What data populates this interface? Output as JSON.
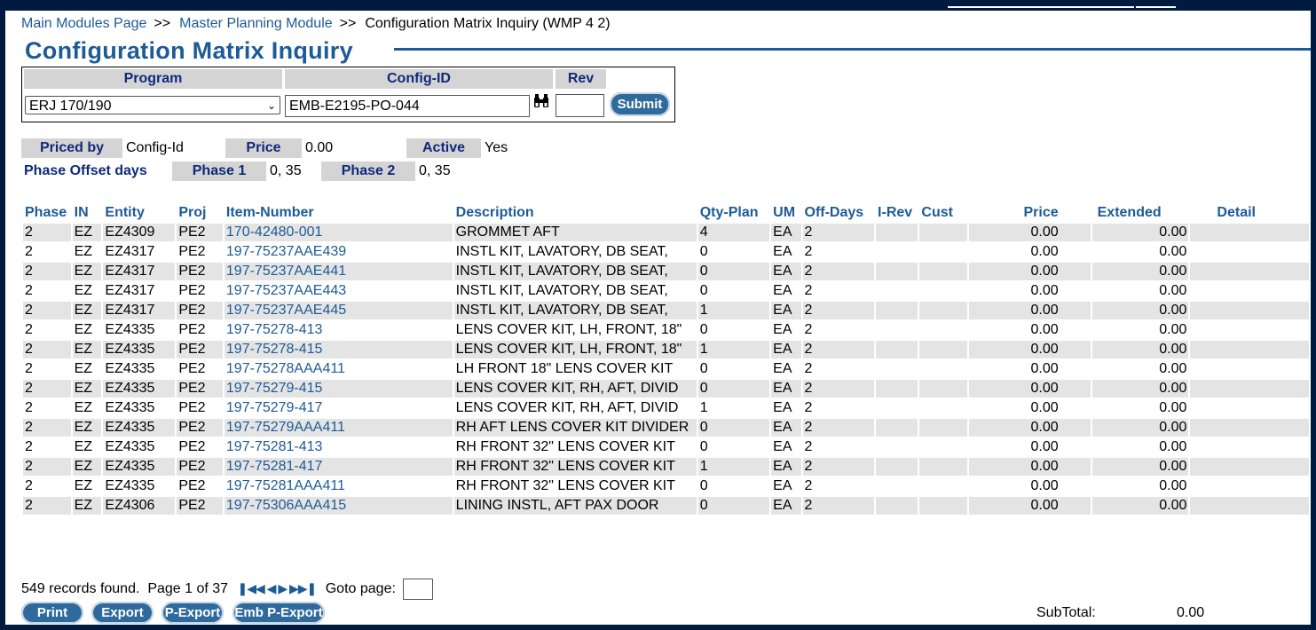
{
  "breadcrumb": {
    "main": "Main Modules Page",
    "sep1": ">>",
    "module": "Master Planning Module",
    "sep2": ">>",
    "current": "Configuration Matrix Inquiry (WMP 4 2)"
  },
  "title": "Configuration Matrix Inquiry",
  "filters": {
    "program_label": "Program",
    "config_label": "Config-ID",
    "rev_label": "Rev",
    "program_value": "ERJ 170/190",
    "config_value": "EMB-E2195-PO-044",
    "rev_value": "",
    "submit_label": "Submit"
  },
  "info": {
    "priced_by_label": "Priced by",
    "priced_by_value": "Config-Id",
    "price_label": "Price",
    "price_value": "0.00",
    "active_label": "Active",
    "active_value": "Yes",
    "phase_offset_label": "Phase Offset days",
    "phase1_label": "Phase 1",
    "phase1_value": "0, 35",
    "phase2_label": "Phase 2",
    "phase2_value": "0, 35"
  },
  "table": {
    "headers": [
      "Phase",
      "IN",
      "Entity",
      "Proj",
      "Item-Number",
      "Description",
      "Qty-Plan",
      "UM",
      "Off-Days",
      "I-Rev",
      "Cust",
      "Price",
      "Extended",
      "Detail"
    ],
    "rows": [
      [
        "2",
        "EZ",
        "EZ4309",
        "PE2",
        "170-42480-001",
        "GROMMET AFT",
        "4",
        "EA",
        "2",
        "",
        "",
        "0.00",
        "0.00",
        ""
      ],
      [
        "2",
        "EZ",
        "EZ4317",
        "PE2",
        "197-75237AAE439",
        "INSTL KIT, LAVATORY, DB SEAT,",
        "0",
        "EA",
        "2",
        "",
        "",
        "0.00",
        "0.00",
        ""
      ],
      [
        "2",
        "EZ",
        "EZ4317",
        "PE2",
        "197-75237AAE441",
        "INSTL KIT, LAVATORY, DB SEAT,",
        "0",
        "EA",
        "2",
        "",
        "",
        "0.00",
        "0.00",
        ""
      ],
      [
        "2",
        "EZ",
        "EZ4317",
        "PE2",
        "197-75237AAE443",
        "INSTL KIT, LAVATORY, DB SEAT,",
        "0",
        "EA",
        "2",
        "",
        "",
        "0.00",
        "0.00",
        ""
      ],
      [
        "2",
        "EZ",
        "EZ4317",
        "PE2",
        "197-75237AAE445",
        "INSTL KIT, LAVATORY, DB SEAT,",
        "1",
        "EA",
        "2",
        "",
        "",
        "0.00",
        "0.00",
        ""
      ],
      [
        "2",
        "EZ",
        "EZ4335",
        "PE2",
        "197-75278-413",
        "LENS COVER KIT, LH, FRONT, 18\"",
        "0",
        "EA",
        "2",
        "",
        "",
        "0.00",
        "0.00",
        ""
      ],
      [
        "2",
        "EZ",
        "EZ4335",
        "PE2",
        "197-75278-415",
        "LENS COVER KIT, LH, FRONT, 18\"",
        "1",
        "EA",
        "2",
        "",
        "",
        "0.00",
        "0.00",
        ""
      ],
      [
        "2",
        "EZ",
        "EZ4335",
        "PE2",
        "197-75278AAA411",
        "LH FRONT 18\" LENS COVER KIT",
        "0",
        "EA",
        "2",
        "",
        "",
        "0.00",
        "0.00",
        ""
      ],
      [
        "2",
        "EZ",
        "EZ4335",
        "PE2",
        "197-75279-415",
        "LENS COVER KIT, RH, AFT, DIVID",
        "0",
        "EA",
        "2",
        "",
        "",
        "0.00",
        "0.00",
        ""
      ],
      [
        "2",
        "EZ",
        "EZ4335",
        "PE2",
        "197-75279-417",
        "LENS COVER KIT, RH, AFT, DIVID",
        "1",
        "EA",
        "2",
        "",
        "",
        "0.00",
        "0.00",
        ""
      ],
      [
        "2",
        "EZ",
        "EZ4335",
        "PE2",
        "197-75279AAA411",
        "RH AFT LENS COVER KIT DIVIDER",
        "0",
        "EA",
        "2",
        "",
        "",
        "0.00",
        "0.00",
        ""
      ],
      [
        "2",
        "EZ",
        "EZ4335",
        "PE2",
        "197-75281-413",
        "RH FRONT 32\" LENS COVER KIT",
        "0",
        "EA",
        "2",
        "",
        "",
        "0.00",
        "0.00",
        ""
      ],
      [
        "2",
        "EZ",
        "EZ4335",
        "PE2",
        "197-75281-417",
        "RH FRONT 32\" LENS COVER KIT",
        "1",
        "EA",
        "2",
        "",
        "",
        "0.00",
        "0.00",
        ""
      ],
      [
        "2",
        "EZ",
        "EZ4335",
        "PE2",
        "197-75281AAA411",
        "RH FRONT 32\" LENS COVER KIT",
        "0",
        "EA",
        "2",
        "",
        "",
        "0.00",
        "0.00",
        ""
      ],
      [
        "2",
        "EZ",
        "EZ4306",
        "PE2",
        "197-75306AAA415",
        "LINING INSTL, AFT PAX DOOR",
        "0",
        "EA",
        "2",
        "",
        "",
        "0.00",
        "0.00",
        ""
      ]
    ]
  },
  "footer": {
    "records_text": "549 records found.",
    "page_text": "Page 1 of 37",
    "goto_label": "Goto page:",
    "goto_value": "",
    "print_label": "Print",
    "export_label": "Export",
    "pexport_label": "P-Export",
    "embpexport_label": "Emb P-Export",
    "subtotal_label": "SubTotal:",
    "subtotal_value": "0.00"
  },
  "icons": {
    "lookup": "binoculars-icon",
    "first": "first-page-icon",
    "prev": "prev-page-icon",
    "next": "next-page-icon",
    "last": "last-page-icon"
  },
  "colors": {
    "link": "#1d5b96",
    "label_bg": "#d4d4d4",
    "label_text": "#102a7a",
    "button_bg": "#2f6a9c",
    "row_stripe": "#e4e4e4",
    "frame": "#001a40"
  }
}
